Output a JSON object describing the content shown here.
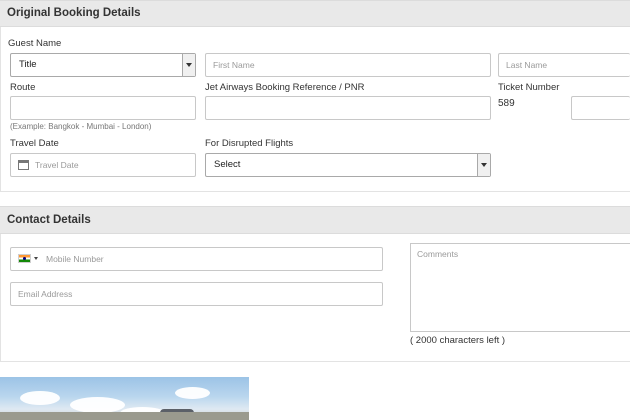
{
  "booking": {
    "header": "Original Booking Details",
    "guest_name_label": "Guest Name",
    "title_select": "Title",
    "first_name_placeholder": "First Name",
    "last_name_placeholder": "Last Name",
    "route_label": "Route",
    "route_hint": "(Example: Bangkok - Mumbai - London)",
    "pnr_label": "Jet Airways Booking Reference / PNR",
    "ticket_label": "Ticket Number",
    "ticket_prefix": "589",
    "travel_date_label": "Travel Date",
    "travel_date_placeholder": "Travel Date",
    "disrupted_label": "For Disrupted Flights",
    "disrupted_select": "Select"
  },
  "contact": {
    "header": "Contact Details",
    "mobile_placeholder": "Mobile Number",
    "email_placeholder": "Email Address",
    "comments_placeholder": "Comments",
    "chars_left": "( 2000 characters left )"
  },
  "icons": {
    "calendar": "calendar-icon",
    "flag": "india-flag-icon",
    "dropdown": "chevron-down-icon"
  },
  "colors": {
    "header_bg": "#e9e9e9",
    "border": "#c8c8c8",
    "placeholder": "#9a9a9a"
  }
}
